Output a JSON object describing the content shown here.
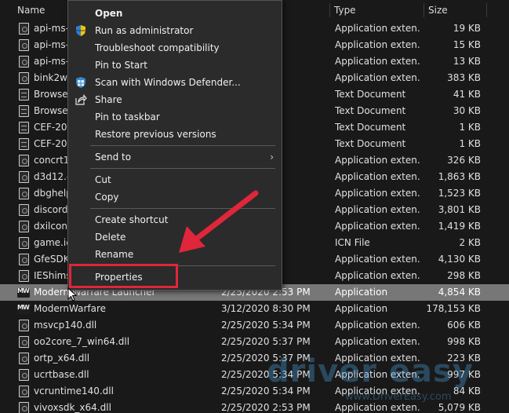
{
  "columns": {
    "name": "Name",
    "type": "Type",
    "size": "Size"
  },
  "files": [
    {
      "name": "api-ms-",
      "date": "PM",
      "type": "Application exten...",
      "size": "19 KB",
      "icon": "dll-file-icon"
    },
    {
      "name": "api-ms-",
      "date": "PM",
      "type": "Application exten...",
      "size": "15 KB",
      "icon": "dll-file-icon"
    },
    {
      "name": "api-ms-",
      "date": "PM",
      "type": "Application exten...",
      "size": "13 KB",
      "icon": "dll-file-icon"
    },
    {
      "name": "bink2w6",
      "date": "PM",
      "type": "Application exten...",
      "size": "383 KB",
      "icon": "dll-file-icon"
    },
    {
      "name": "Browser",
      "date": "PM",
      "type": "Text Document",
      "size": "41 KB",
      "icon": "text-file-icon"
    },
    {
      "name": "Browser",
      "date": "PM",
      "type": "Text Document",
      "size": "30 KB",
      "icon": "text-file-icon"
    },
    {
      "name": "CEF-202",
      "date": "PM",
      "type": "Text Document",
      "size": "1 KB",
      "icon": "text-file-icon"
    },
    {
      "name": "CEF-202",
      "date": "PM",
      "type": "Text Document",
      "size": "1 KB",
      "icon": "text-file-icon"
    },
    {
      "name": "concrt14",
      "date": "PM",
      "type": "Application exten...",
      "size": "326 KB",
      "icon": "dll-file-icon"
    },
    {
      "name": "d3d12.d",
      "date": "PM",
      "type": "Application exten...",
      "size": "1,863 KB",
      "icon": "dll-file-icon"
    },
    {
      "name": "dbghelp",
      "date": "PM",
      "type": "Application exten...",
      "size": "1,523 KB",
      "icon": "dll-file-icon"
    },
    {
      "name": "discord_",
      "date": "PM",
      "type": "Application exten...",
      "size": "3,801 KB",
      "icon": "dll-file-icon"
    },
    {
      "name": "dxilconv",
      "date": "PM",
      "type": "Application exten...",
      "size": "1,419 KB",
      "icon": "dll-file-icon"
    },
    {
      "name": "game.ic",
      "date": "PM",
      "type": "ICN File",
      "size": "2 KB",
      "icon": "file-icon"
    },
    {
      "name": "GfeSDK.",
      "date": "PM",
      "type": "Application exten...",
      "size": "4,130 KB",
      "icon": "dll-file-icon"
    },
    {
      "name": "IEShims",
      "date": "PM",
      "type": "Application exten...",
      "size": "298 KB",
      "icon": "dll-file-icon"
    },
    {
      "name": "Modern Warfare Launcher",
      "date": "2/25/2020 2:53 PM",
      "type": "Application",
      "size": "4,854 KB",
      "icon": "modern-warfare-app-icon",
      "selected": true
    },
    {
      "name": "ModernWarfare",
      "date": "3/12/2020 8:30 PM",
      "type": "Application",
      "size": "178,153 KB",
      "icon": "modern-warfare-app-icon"
    },
    {
      "name": "msvcp140.dll",
      "date": "2/25/2020 5:34 PM",
      "type": "Application exten...",
      "size": "606 KB",
      "icon": "dll-file-icon"
    },
    {
      "name": "oo2core_7_win64.dll",
      "date": "2/25/2020 5:37 PM",
      "type": "Application exten...",
      "size": "998 KB",
      "icon": "dll-file-icon"
    },
    {
      "name": "ortp_x64.dll",
      "date": "2/25/2020 5:37 PM",
      "type": "Application exten...",
      "size": "223 KB",
      "icon": "dll-file-icon"
    },
    {
      "name": "ucrtbase.dll",
      "date": "2/25/2020 5:34 PM",
      "type": "Application exten...",
      "size": "997 KB",
      "icon": "dll-file-icon"
    },
    {
      "name": "vcruntime140.dll",
      "date": "2/25/2020 5:34 PM",
      "type": "Application exten...",
      "size": "84 KB",
      "icon": "dll-file-icon"
    },
    {
      "name": "vivoxsdk_x64.dll",
      "date": "2/25/2020 2:53 PM",
      "type": "Application exten...",
      "size": "5,079 KB",
      "icon": "dll-file-icon"
    }
  ],
  "context_menu": {
    "open": "Open",
    "run_as_admin": "Run as administrator",
    "troubleshoot": "Troubleshoot compatibility",
    "pin_to_start": "Pin to Start",
    "scan_defender": "Scan with Windows Defender...",
    "share": "Share",
    "pin_to_taskbar": "Pin to taskbar",
    "restore_previous": "Restore previous versions",
    "send_to": "Send to",
    "cut": "Cut",
    "copy": "Copy",
    "create_shortcut": "Create shortcut",
    "delete": "Delete",
    "rename": "Rename",
    "properties": "Properties"
  },
  "watermark": {
    "logo": "driver easy",
    "url": "www.DriverEasy.com"
  },
  "colors": {
    "background": "#191919",
    "menu_background": "#2b2b2b",
    "selected_row": "#777777",
    "highlight_red": "#e0263a",
    "shield_blue": "#2f7fd6",
    "shield_yellow": "#f2c400"
  }
}
